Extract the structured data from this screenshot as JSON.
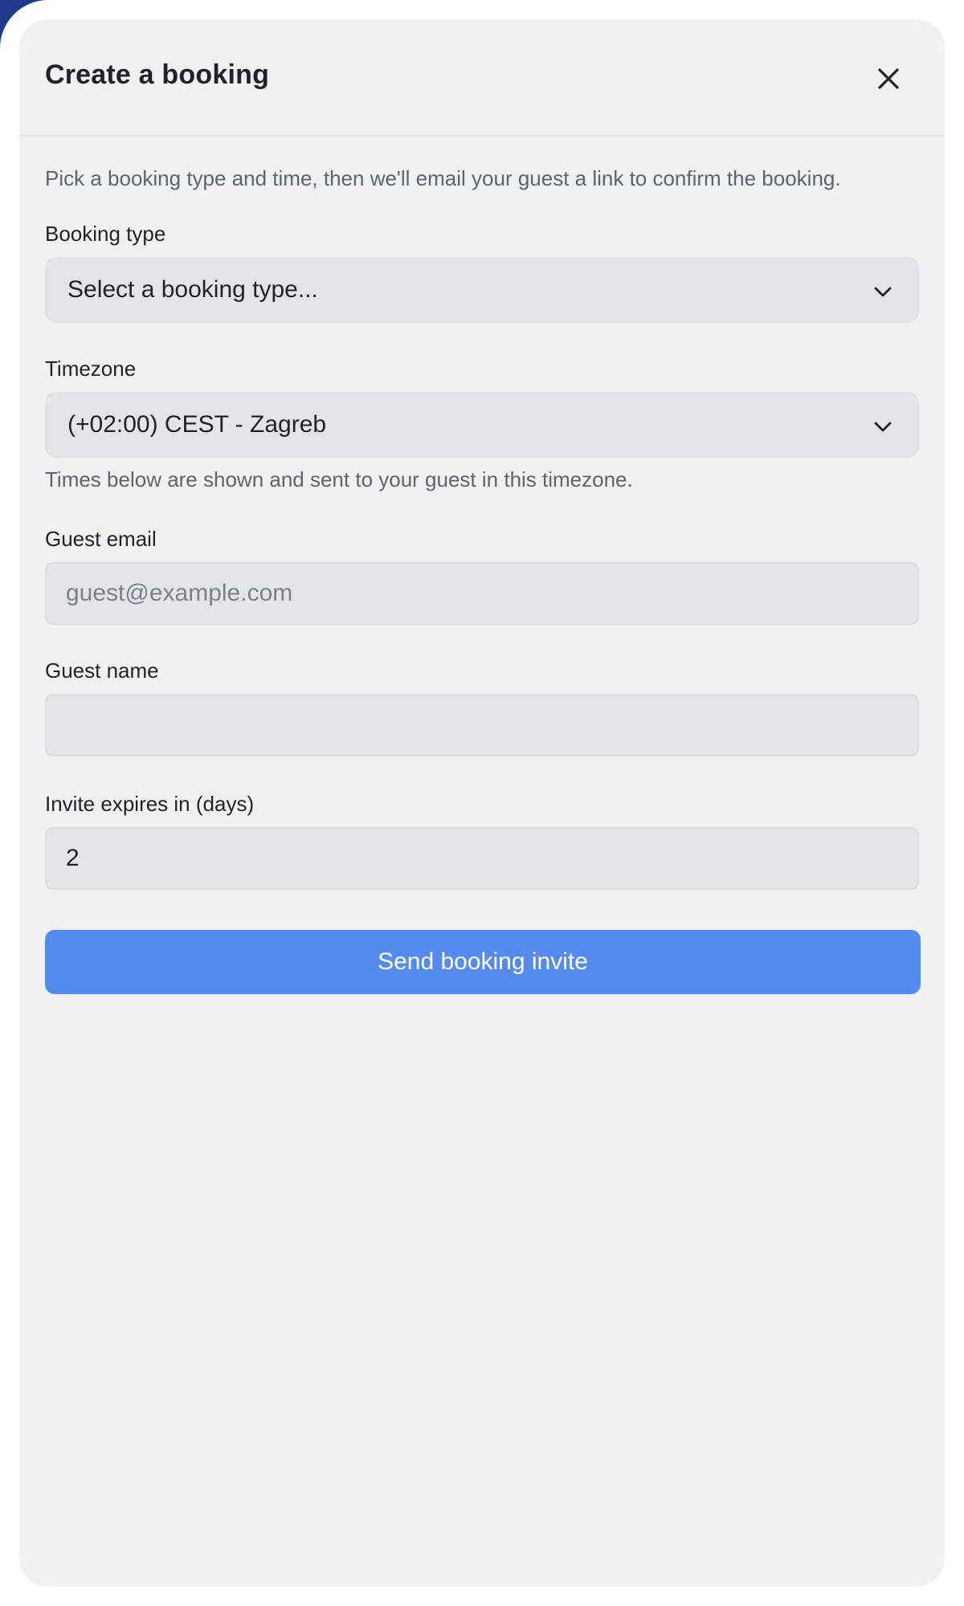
{
  "modal": {
    "title": "Create a booking",
    "description": "Pick a booking type and time, then we'll email your guest a link to confirm the booking."
  },
  "icons": {
    "close": "close-icon",
    "chevron": "chevron-down-icon"
  },
  "form": {
    "booking_type": {
      "label": "Booking type",
      "selected": "Select a booking type..."
    },
    "timezone": {
      "label": "Timezone",
      "selected": "(+02:00) CEST - Zagreb",
      "helper": "Times below are shown and sent to your guest in this timezone."
    },
    "guest_email": {
      "label": "Guest email",
      "value": "",
      "placeholder": "guest@example.com"
    },
    "guest_name": {
      "label": "Guest name",
      "value": "",
      "placeholder": ""
    },
    "invite_expires": {
      "label": "Invite expires in (days)",
      "value": "2"
    },
    "submit_label": "Send booking invite"
  },
  "colors": {
    "primary_button": "#558aee",
    "modal_background": "#f0f1f3",
    "field_background": "#e4e5e8"
  }
}
